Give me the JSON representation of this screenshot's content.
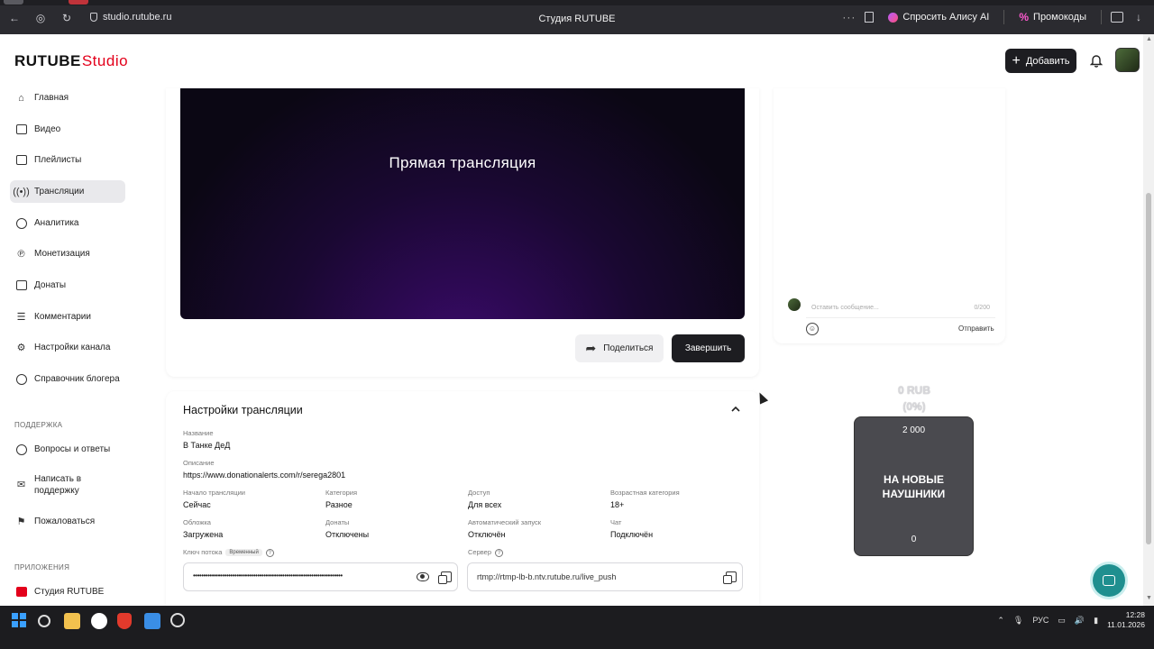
{
  "browser": {
    "url": "studio.rutube.ru",
    "title": "Студия RUTUBE",
    "alice_label": "Спросить Алису AI",
    "promo_label": "Промокоды"
  },
  "header": {
    "logo_main": "RUTUBE",
    "logo_studio": "Studio",
    "add_label": "Добавить"
  },
  "sidebar": {
    "items": [
      {
        "label": "Главная",
        "icon": "home-icon"
      },
      {
        "label": "Видео",
        "icon": "video-icon"
      },
      {
        "label": "Плейлисты",
        "icon": "playlist-icon"
      },
      {
        "label": "Трансляции",
        "icon": "broadcast-icon",
        "active": true
      },
      {
        "label": "Аналитика",
        "icon": "analytics-icon"
      },
      {
        "label": "Монетизация",
        "icon": "monetization-icon"
      },
      {
        "label": "Донаты",
        "icon": "donate-icon"
      },
      {
        "label": "Комментарии",
        "icon": "comments-icon"
      },
      {
        "label": "Настройки канала",
        "icon": "gear-icon"
      },
      {
        "label": "Справочник блогера",
        "icon": "guide-icon"
      }
    ],
    "support_title": "ПОДДЕРЖКА",
    "support_items": [
      {
        "label": "Вопросы и ответы",
        "icon": "help-icon"
      },
      {
        "label_line1": "Написать в",
        "label_line2": "поддержку",
        "icon": "mail-icon"
      },
      {
        "label": "Пожаловаться",
        "icon": "flag-icon"
      }
    ],
    "apps_title": "ПРИЛОЖЕНИЯ",
    "apps_items": [
      {
        "label": "Студия RUTUBE",
        "icon": "studio-app-icon"
      }
    ]
  },
  "stream": {
    "preview_title": "Прямая трансляция",
    "share_label": "Поделиться",
    "finish_label": "Завершить"
  },
  "settings": {
    "title": "Настройки трансляции",
    "name_label": "Название",
    "name_value": "В Танке ДеД",
    "description_label": "Описание",
    "description_value": "https://www.donationalerts.com/r/serega2801",
    "start_label": "Начало трансляции",
    "start_value": "Сейчас",
    "category_label": "Категория",
    "category_value": "Разное",
    "access_label": "Доступ",
    "access_value": "Для всех",
    "age_label": "Возрастная категория",
    "age_value": "18+",
    "cover_label": "Обложка",
    "cover_value": "Загружена",
    "donations_label": "Донаты",
    "donations_value": "Отключены",
    "autostart_label": "Автоматический запуск",
    "autostart_value": "Отключён",
    "chat_label": "Чат",
    "chat_value": "Подключён",
    "key_label": "Ключ потока",
    "key_badge": "Временный",
    "key_masked": "••••••••••••••••••••••••••••••••••••••••••••••••••••••••••••••••••••••••",
    "server_label": "Сервер",
    "server_value": "rtmp://rtmp-lb-b.ntv.rutube.ru/live_push"
  },
  "chat": {
    "placeholder": "Оставить сообщение...",
    "counter": "0/200",
    "send_label": "Отправить"
  },
  "goal": {
    "amount_line1": "0 RUB",
    "amount_line2": "(0%)",
    "target": "2 000",
    "text_line1": "НА НОВЫЕ",
    "text_line2": "НАУШНИКИ",
    "current": "0"
  },
  "taskbar": {
    "lang": "РУС",
    "time": "12:28",
    "date": "11.01.2026"
  }
}
